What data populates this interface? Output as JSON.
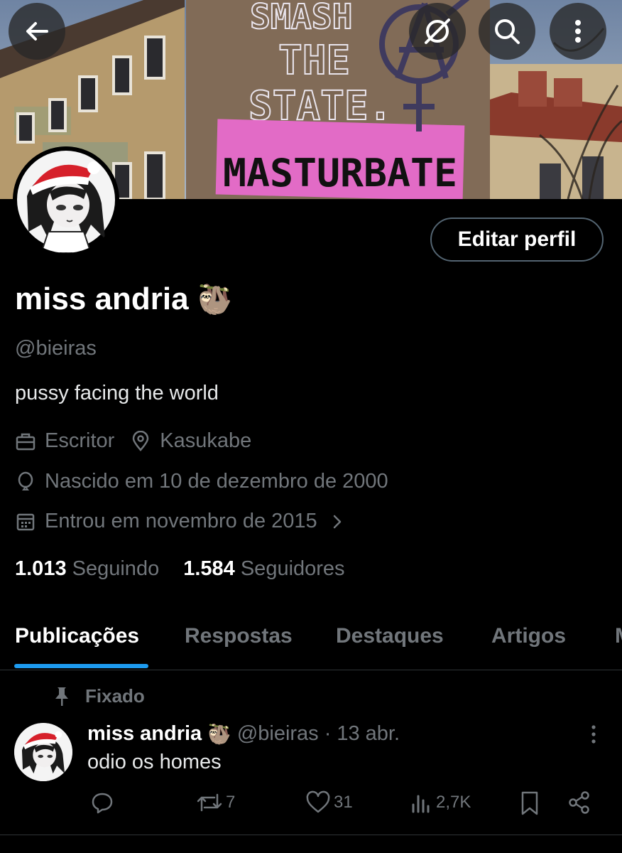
{
  "header": {
    "back_icon": "arrow-left-icon",
    "grok_icon": "grok-icon",
    "search_icon": "search-icon",
    "more_icon": "more-vertical-icon"
  },
  "banner": {
    "graffiti_line1": "SMASH",
    "graffiti_line2": "THE",
    "graffiti_line3": "STATE.",
    "graffiti_sign": "MASTURBATE",
    "sign_color": "#e26bc6"
  },
  "profile": {
    "edit_label": "Editar perfil",
    "name": "miss andria",
    "name_emoji": "🦥",
    "handle": "@bieiras",
    "bio": "pussy facing the world",
    "job": "Escritor",
    "location": "Kasukabe",
    "birth": "Nascido em 10 de dezembro de 2000",
    "joined": "Entrou em novembro de 2015",
    "following_count": "1.013",
    "following_label": "Seguindo",
    "followers_count": "1.584",
    "followers_label": "Seguidores"
  },
  "tabs": [
    {
      "label": "Publicações"
    },
    {
      "label": "Respostas"
    },
    {
      "label": "Destaques"
    },
    {
      "label": "Artigos"
    },
    {
      "label": "M"
    }
  ],
  "post": {
    "pinned_label": "Fixado",
    "author_name": "miss andria",
    "author_emoji": "🦥",
    "author_handle": "@bieiras",
    "separator": "·",
    "date": "13 abr.",
    "text": "odio os homes",
    "reposts": "7",
    "likes": "31",
    "views": "2,7K"
  },
  "colors": {
    "accent": "#1d9bf0",
    "background": "#000000",
    "muted": "#71767b",
    "border": "#536471"
  }
}
